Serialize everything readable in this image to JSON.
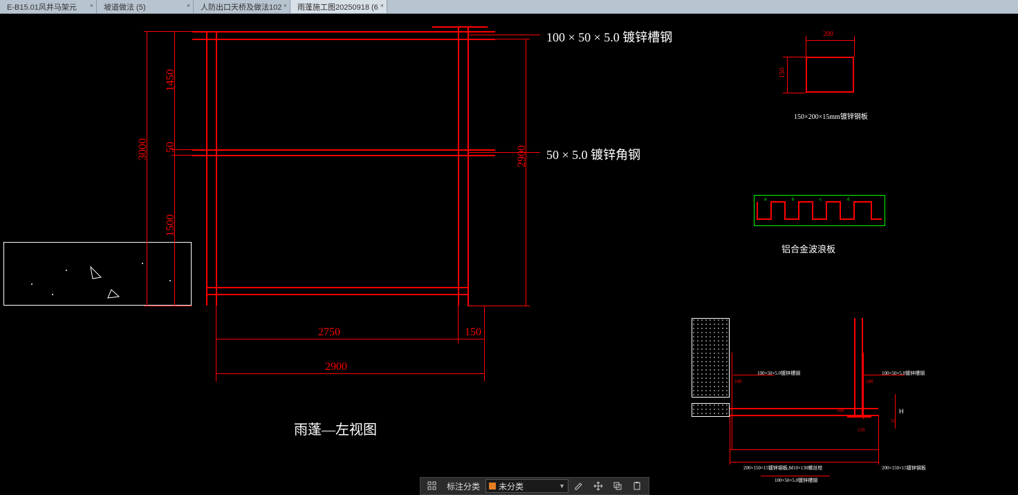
{
  "tabs": [
    {
      "label": "E-B15.01风井马架元"
    },
    {
      "label": "坡道做法 (5)"
    },
    {
      "label": "人防出口天桥及做法102"
    },
    {
      "label": "雨蓬施工图20250918 (6",
      "active": true
    }
  ],
  "main_view": {
    "title": "雨蓬—左视图",
    "annotations": {
      "top": "100 × 50 × 5.0 镀锌槽钢",
      "mid": "50 × 5.0 镀锌角钢"
    },
    "dims_v": {
      "d1": "1450",
      "d2": "50",
      "d3": "1500",
      "total": "3000",
      "right": "2900"
    },
    "dims_h": {
      "d1": "2750",
      "d2": "150",
      "total": "2900"
    }
  },
  "detail_tr": {
    "w": "200",
    "h": "150",
    "caption": "150×200×15mm镀锌钢板"
  },
  "detail_mr": {
    "caption": "铝合金波浪板"
  },
  "detail_br": {
    "labels": {
      "a": "100×50×5.0镀锌槽钢",
      "b": "100×50×5.0镀锌槽钢",
      "c": "200×150×15镀锌钢板,M10×130螺丝栓",
      "d": "200×150×15镀锌钢板",
      "e": "100×50×5.0镀锌槽钢"
    },
    "dims": {
      "d180a": "180",
      "d180b": "180",
      "d100": "100",
      "d150": "150",
      "d50": "50",
      "H": "H"
    }
  },
  "toolbar": {
    "classify_label": "标注分类",
    "select_value": "未分类"
  }
}
